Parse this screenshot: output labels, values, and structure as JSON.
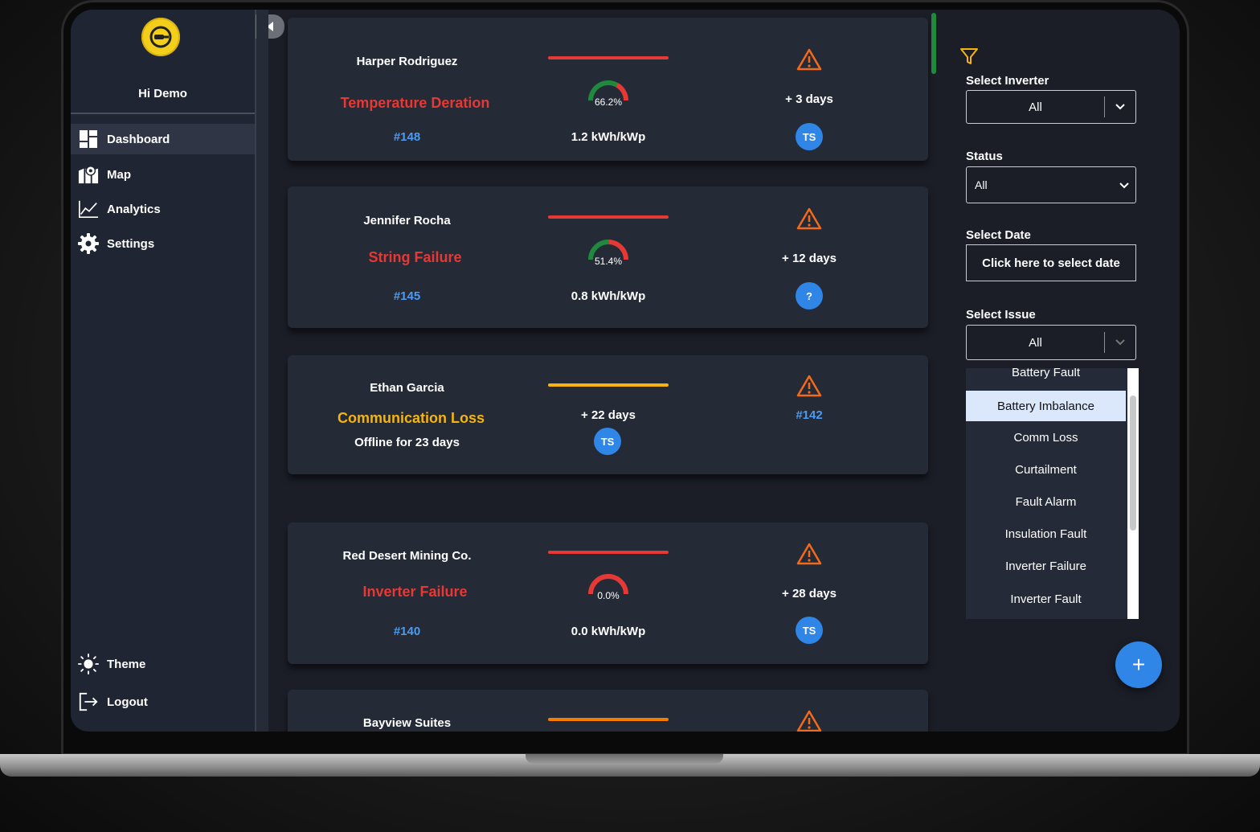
{
  "sidebar": {
    "greeting": "Hi Demo",
    "nav": [
      {
        "label": "Dashboard",
        "icon": "dashboard-icon"
      },
      {
        "label": "Map",
        "icon": "map-icon"
      },
      {
        "label": "Analytics",
        "icon": "analytics-icon"
      },
      {
        "label": "Settings",
        "icon": "gear-icon"
      }
    ],
    "bottom": [
      {
        "label": "Theme",
        "icon": "sun-icon"
      },
      {
        "label": "Logout",
        "icon": "logout-icon"
      }
    ]
  },
  "cards": [
    {
      "name": "Harper Rodriguez",
      "issue": "Temperature Deration",
      "issue_color": "#e53935",
      "ticket": "#148",
      "line_color": "#e53935",
      "percent": "66.2%",
      "percent_value": 66.2,
      "energy": "1.2 kWh/kWp",
      "days": "+ 3 days",
      "badge": "TS"
    },
    {
      "name": "Jennifer Rocha",
      "issue": "String Failure",
      "issue_color": "#e53935",
      "ticket": "#145",
      "line_color": "#e53935",
      "percent": "51.4%",
      "percent_value": 51.4,
      "energy": "0.8 kWh/kWp",
      "days": "+ 12 days",
      "badge": "?"
    },
    {
      "name": "Ethan Garcia",
      "issue": "Communication Loss",
      "issue_color": "#f5b40f",
      "sub": "Offline for 23 days",
      "line_color": "#f5b40f",
      "days": "+ 22 days",
      "badge": "TS",
      "ticket": "#142"
    },
    {
      "name": "Red Desert Mining Co.",
      "issue": "Inverter Failure",
      "issue_color": "#e53935",
      "ticket": "#140",
      "line_color": "#e53935",
      "percent": "0.0%",
      "percent_value": 0.0,
      "energy": "0.0 kWh/kWp",
      "days": "+ 28 days",
      "badge": "TS"
    },
    {
      "name": "Bayview Suites",
      "line_color": "#f57c00"
    }
  ],
  "filters": {
    "inverter_label": "Select Inverter",
    "inverter_value": "All",
    "status_label": "Status",
    "status_value": "All",
    "date_label": "Select Date",
    "date_button": "Click here to select date",
    "issue_label": "Select Issue",
    "issue_value": "All",
    "issue_options": [
      "Battery Fault",
      "Battery Imbalance",
      "Comm Loss",
      "Curtailment",
      "Fault Alarm",
      "Insulation Fault",
      "Inverter Failure",
      "Inverter Fault"
    ],
    "highlighted_option": "Battery Imbalance"
  },
  "fab_label": "+",
  "colors": {
    "accent": "#2f86e6",
    "warning": "#f26a1b",
    "gauge_green": "#1f8a3e",
    "gauge_red": "#e53935"
  }
}
